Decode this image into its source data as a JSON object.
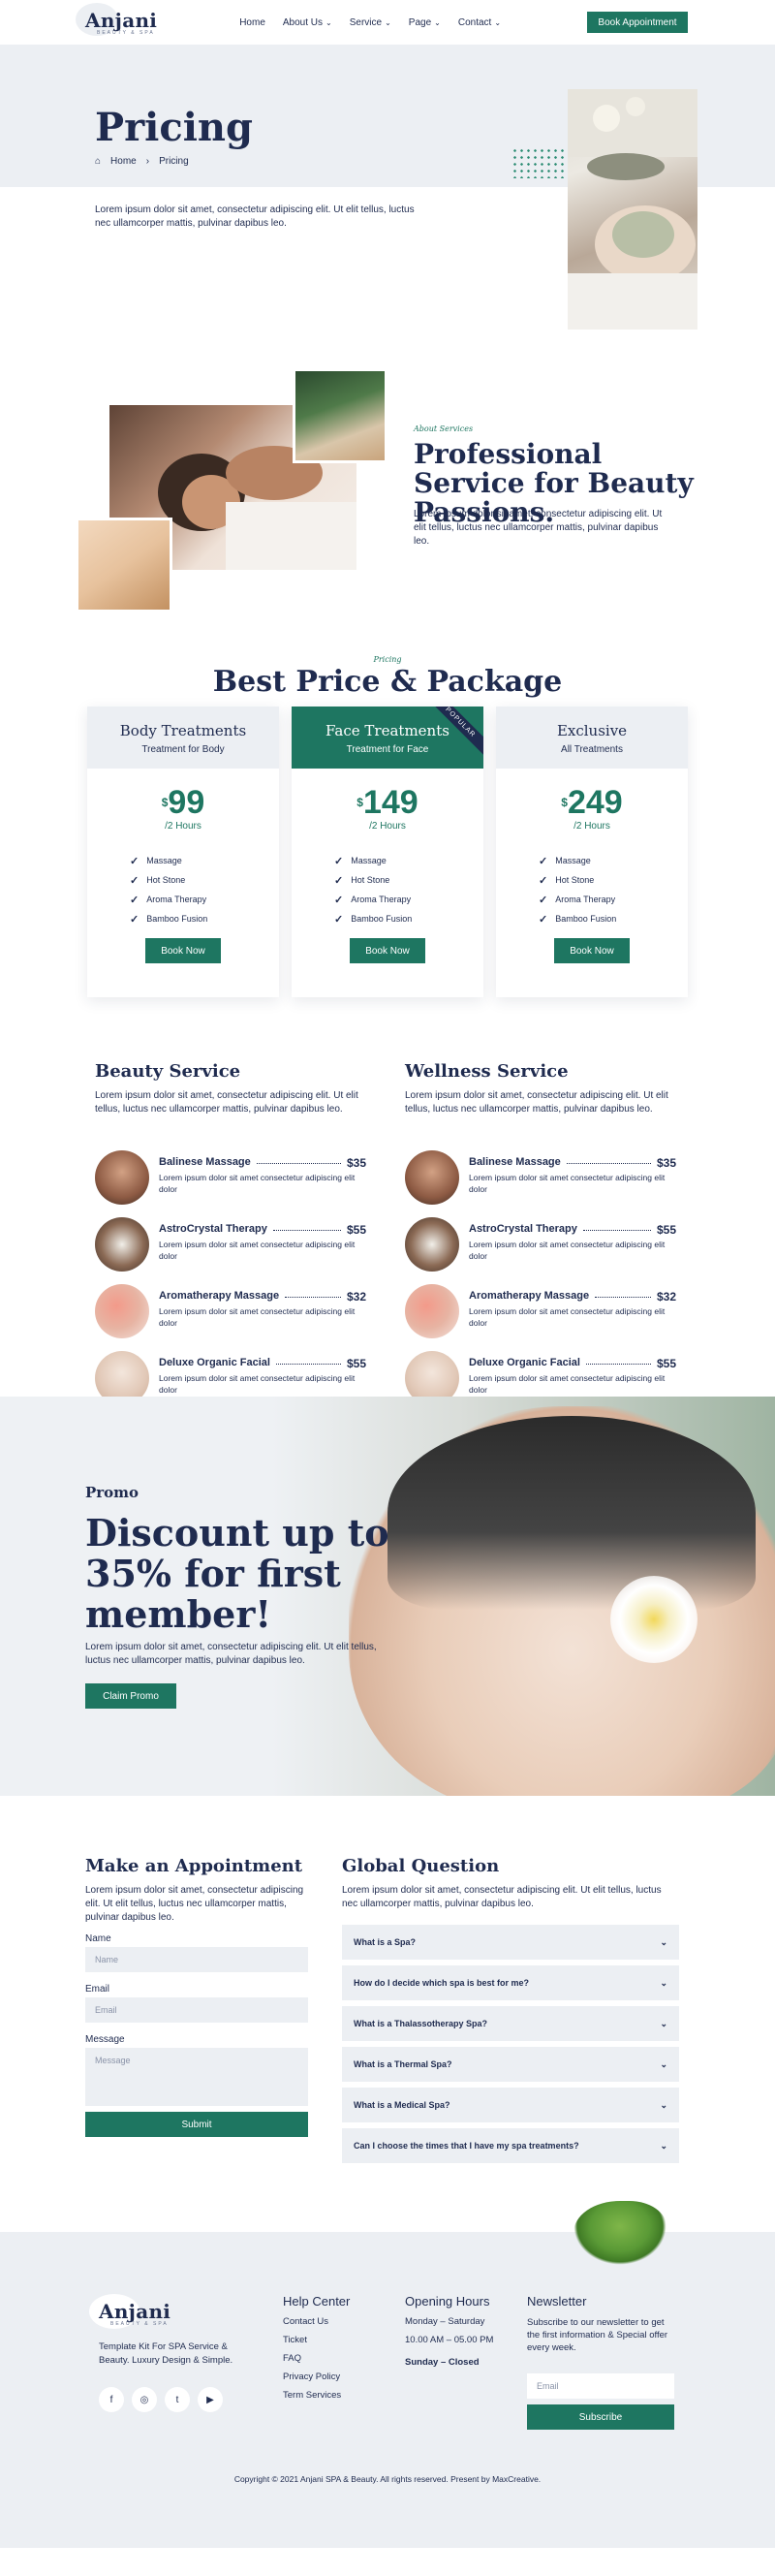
{
  "header": {
    "logo_name": "Anjani",
    "logo_sub": "BEAUTY & SPA",
    "nav": [
      {
        "label": "Home",
        "has_menu": false
      },
      {
        "label": "About Us",
        "has_menu": true
      },
      {
        "label": "Service",
        "has_menu": true
      },
      {
        "label": "Page",
        "has_menu": true
      },
      {
        "label": "Contact",
        "has_menu": true
      }
    ],
    "cta_label": "Book Appointment"
  },
  "hero": {
    "title": "Pricing",
    "breadcrumb_home": "Home",
    "breadcrumb_current": "Pricing",
    "text": "Lorem ipsum dolor sit amet, consectetur adipiscing elit. Ut elit tellus, luctus nec ullamcorper mattis, pulvinar dapibus leo."
  },
  "professional": {
    "label": "About Services",
    "title": "Professional Service for Beauty Passions.",
    "text": "Lorem ipsum dolor sit amet, consectetur adipiscing elit. Ut elit tellus, luctus nec ullamcorper mattis, pulvinar dapibus leo."
  },
  "packages": {
    "label": "Pricing",
    "title": "Best Price & Package",
    "cards": [
      {
        "name": "Body Treatments",
        "sub": "Treatment for Body",
        "currency": "$",
        "price": "99",
        "per": "/2 Hours",
        "features": [
          "Massage",
          "Hot Stone",
          "Aroma Therapy",
          "Bamboo Fusion"
        ],
        "button": "Book Now"
      },
      {
        "name": "Face Treatments",
        "sub": "Treatment for Face",
        "currency": "$",
        "price": "149",
        "per": "/2 Hours",
        "features": [
          "Massage",
          "Hot Stone",
          "Aroma Therapy",
          "Bamboo Fusion"
        ],
        "button": "Book Now",
        "ribbon": "POPULAR"
      },
      {
        "name": "Exclusive",
        "sub": "All Treatments",
        "currency": "$",
        "price": "249",
        "per": "/2 Hours",
        "features": [
          "Massage",
          "Hot Stone",
          "Aroma Therapy",
          "Bamboo Fusion"
        ],
        "button": "Book Now"
      }
    ]
  },
  "services": {
    "beauty": {
      "title": "Beauty Service",
      "intro": "Lorem ipsum dolor sit amet, consectetur adipiscing elit. Ut elit tellus, luctus nec ullamcorper mattis, pulvinar dapibus leo.",
      "items": [
        {
          "name": "Balinese Massage",
          "price": "$35",
          "desc": "Lorem ipsum dolor sit amet consectetur adipiscing elit dolor"
        },
        {
          "name": "AstroCrystal Therapy",
          "price": "$55",
          "desc": "Lorem ipsum dolor sit amet consectetur adipiscing elit dolor"
        },
        {
          "name": "Aromatherapy Massage",
          "price": "$32",
          "desc": "Lorem ipsum dolor sit amet consectetur adipiscing elit dolor"
        },
        {
          "name": "Deluxe Organic Facial",
          "price": "$55",
          "desc": "Lorem ipsum dolor sit amet consectetur adipiscing elit dolor"
        }
      ]
    },
    "wellness": {
      "title": "Wellness Service",
      "intro": "Lorem ipsum dolor sit amet, consectetur adipiscing elit. Ut elit tellus, luctus nec ullamcorper mattis, pulvinar dapibus leo.",
      "items": [
        {
          "name": "Balinese Massage",
          "price": "$35",
          "desc": "Lorem ipsum dolor sit amet consectetur adipiscing elit dolor"
        },
        {
          "name": "AstroCrystal Therapy",
          "price": "$55",
          "desc": "Lorem ipsum dolor sit amet consectetur adipiscing elit dolor"
        },
        {
          "name": "Aromatherapy Massage",
          "price": "$32",
          "desc": "Lorem ipsum dolor sit amet consectetur adipiscing elit dolor"
        },
        {
          "name": "Deluxe Organic Facial",
          "price": "$55",
          "desc": "Lorem ipsum dolor sit amet consectetur adipiscing elit dolor"
        }
      ]
    }
  },
  "promo": {
    "label": "Promo",
    "title": "Discount up to 35% for first member!",
    "text": "Lorem ipsum dolor sit amet, consectetur adipiscing elit. Ut elit tellus, luctus nec ullamcorper mattis, pulvinar dapibus leo.",
    "button": "Claim Promo"
  },
  "appointment": {
    "title": "Make an Appointment",
    "text": "Lorem ipsum dolor sit amet, consectetur adipiscing elit. Ut elit tellus, luctus nec ullamcorper mattis, pulvinar dapibus leo.",
    "name_label": "Name",
    "name_placeholder": "Name",
    "email_label": "Email",
    "email_placeholder": "Email",
    "message_label": "Message",
    "message_placeholder": "Message",
    "submit": "Submit"
  },
  "faq": {
    "title": "Global Question",
    "text": "Lorem ipsum dolor sit amet, consectetur adipiscing elit. Ut elit tellus, luctus nec ullamcorper mattis, pulvinar dapibus leo.",
    "items": [
      "What is a Spa?",
      "How do I decide which spa is best for me?",
      "What is a Thalassotherapy Spa?",
      "What is a Thermal Spa?",
      "What is a Medical Spa?",
      "Can I choose the times that I have my spa treatments?"
    ]
  },
  "footer": {
    "logo_name": "Anjani",
    "logo_sub": "BEAUTY & SPA",
    "tagline": "Template Kit For SPA Service & Beauty. Luxury Design & Simple.",
    "socials": [
      "facebook-icon",
      "instagram-icon",
      "twitter-icon",
      "youtube-icon"
    ],
    "help_title": "Help Center",
    "help_links": [
      "Contact Us",
      "Ticket",
      "FAQ",
      "Privacy Policy",
      "Term Services"
    ],
    "hours_title": "Opening Hours",
    "hours_days": "Monday – Saturday",
    "hours_time": "10.00 AM – 05.00 PM",
    "hours_closed": "Sunday – Closed",
    "newsletter_title": "Newsletter",
    "newsletter_text": "Subscribe to our newsletter to get the first information & Special offer every week.",
    "newsletter_placeholder": "Email",
    "newsletter_button": "Subscribe",
    "copyright": "Copyright © 2021 Anjani SPA & Beauty. All rights reserved. Present by MaxCreative."
  }
}
